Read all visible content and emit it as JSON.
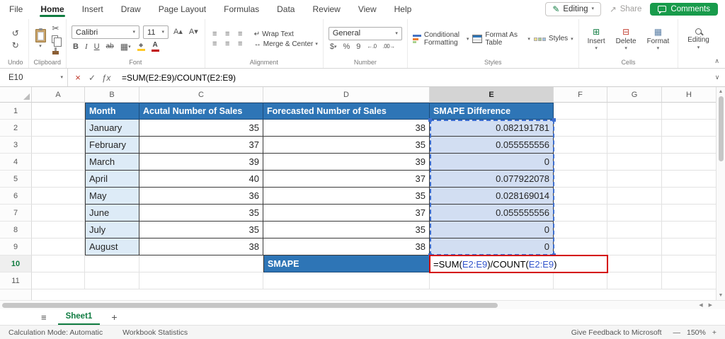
{
  "colors": {
    "excel_green": "#107C41",
    "comments_green": "#189B4B",
    "table_header_blue": "#2E75B6",
    "month_fill_blue": "#DDEBF7",
    "selection_fill_blue": "#D2DEF2",
    "formula_ref_blue": "#3355CC",
    "active_cell_border_red": "#D40000"
  },
  "icons": {
    "dropdown": "▾",
    "undo": "↺",
    "redo": "↻",
    "cut": "✂",
    "bold": "B",
    "italic": "I",
    "underline": "U",
    "strikethrough": "ab",
    "grow_font": "A▴",
    "shrink_font": "A▾",
    "borders": "▦",
    "fill_color": "◆",
    "font_color": "A",
    "align_lines": "≡",
    "wrap": "↵",
    "merge": "↔",
    "dollar": "$",
    "percent": "%",
    "comma": "9",
    "increase_decimal": "←.0",
    "decrease_decimal": ".00→",
    "insert": "⊞",
    "delete": "⊟",
    "format": "▦",
    "check": "✓",
    "cancel": "×",
    "fx": "ƒx",
    "pencil": "✎",
    "share_arrow": "↗",
    "hamburger": "≡",
    "add_sheet": "+",
    "scroll_up": "▲",
    "scroll_down": "▼",
    "scroll_left": "◀",
    "scroll_right": "▶",
    "collapse_ribbon": "∧",
    "expand_formula_bar": "∨",
    "zoom_out": "—",
    "zoom_in": "+"
  },
  "menubar": {
    "tabs": [
      "File",
      "Home",
      "Insert",
      "Draw",
      "Page Layout",
      "Formulas",
      "Data",
      "Review",
      "View",
      "Help"
    ],
    "active_tab": "Home",
    "editing_button": "Editing",
    "share_button": "Share",
    "comments_button": "Comments"
  },
  "ribbon": {
    "groups": {
      "undo": {
        "label": "Undo"
      },
      "clipboard": {
        "label": "Clipboard"
      },
      "font": {
        "label": "Font",
        "font_name": "Calibri",
        "font_size": "11"
      },
      "alignment": {
        "label": "Alignment",
        "wrap_text": "Wrap Text",
        "merge_center": "Merge & Center"
      },
      "number": {
        "label": "Number",
        "format": "General"
      },
      "styles": {
        "label": "Styles",
        "conditional": "Conditional Formatting",
        "format_table": "Format As Table",
        "styles_btn": "Styles"
      },
      "cells": {
        "label": "Cells",
        "insert": "Insert",
        "delete": "Delete",
        "format": "Format"
      },
      "editing": {
        "button": "Editing"
      }
    }
  },
  "formula_bar": {
    "name_box": "E10",
    "formula": "=SUM(E2:E9)/COUNT(E2:E9)"
  },
  "sheet": {
    "column_headers": [
      "A",
      "B",
      "C",
      "D",
      "E",
      "F",
      "G",
      "H"
    ],
    "row_numbers": [
      "1",
      "2",
      "3",
      "4",
      "5",
      "6",
      "7",
      "8",
      "9",
      "10",
      "11"
    ],
    "selected_column": "E",
    "selected_row": "10",
    "table_headers": {
      "month": "Month",
      "actual": "Acutal Number of Sales",
      "forecast": "Forecasted Number of Sales",
      "smape": "SMAPE Difference"
    },
    "rows": [
      {
        "month": "January",
        "actual": "35",
        "forecast": "38",
        "smape": "0.082191781"
      },
      {
        "month": "February",
        "actual": "37",
        "forecast": "35",
        "smape": "0.055555556"
      },
      {
        "month": "March",
        "actual": "39",
        "forecast": "39",
        "smape": "0"
      },
      {
        "month": "April",
        "actual": "40",
        "forecast": "37",
        "smape": "0.077922078"
      },
      {
        "month": "May",
        "actual": "36",
        "forecast": "35",
        "smape": "0.028169014"
      },
      {
        "month": "June",
        "actual": "35",
        "forecast": "37",
        "smape": "0.055555556"
      },
      {
        "month": "July",
        "actual": "35",
        "forecast": "35",
        "smape": "0"
      },
      {
        "month": "August",
        "actual": "38",
        "forecast": "38",
        "smape": "0"
      }
    ],
    "smape_row": {
      "label": "SMAPE",
      "formula_prefix": "=SUM(",
      "formula_ref1": "E2:E9",
      "formula_mid": ")/COUNT(",
      "formula_ref2": "E2:E9",
      "formula_suffix": ")"
    }
  },
  "sheet_tabs": {
    "active": "Sheet1"
  },
  "status_bar": {
    "calculation_mode": "Calculation Mode: Automatic",
    "workbook_statistics": "Workbook Statistics",
    "feedback": "Give Feedback to Microsoft",
    "zoom": "150%"
  }
}
